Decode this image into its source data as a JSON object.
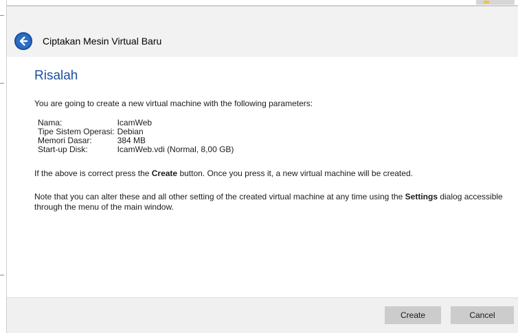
{
  "window": {
    "title": "Ciptakan Mesin Virtual Baru"
  },
  "icons": {
    "back": "back-arrow-icon"
  },
  "summary": {
    "heading": "Risalah",
    "intro": "You are going to create a new virtual machine with the following parameters:",
    "parameters": [
      {
        "label": "Nama:",
        "value": "IcamWeb"
      },
      {
        "label": "Tipe Sistem Operasi:",
        "value": "Debian"
      },
      {
        "label": "Memori Dasar:",
        "value": "384 MB"
      },
      {
        "label": "Start-up Disk:",
        "value": "IcamWeb.vdi (Normal, 8,00 GB)"
      }
    ],
    "para1_pre": "If the above is correct press the ",
    "para1_bold": "Create",
    "para1_post": " button. Once you press it, a new virtual machine will be created.",
    "para2_pre": "Note that you can alter these and all other setting of the created virtual machine at any time using the ",
    "para2_bold": "Settings",
    "para2_post": " dialog accessible through the menu of the main window."
  },
  "buttons": {
    "create": "Create",
    "cancel": "Cancel"
  },
  "colors": {
    "heading": "#1a4fa0",
    "header_bg": "#f2f2f2",
    "footer_bg": "#f0f0f0",
    "button_bg": "#cccccc",
    "back_button": "#2b6cc4"
  }
}
